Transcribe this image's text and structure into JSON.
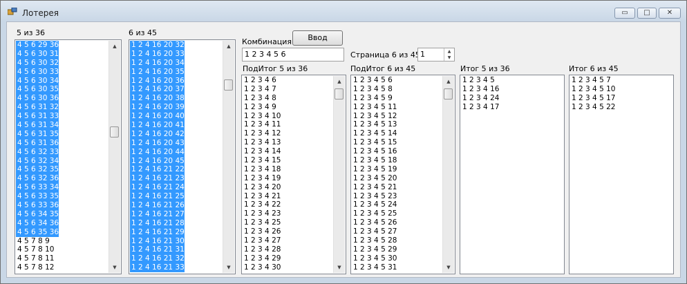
{
  "window": {
    "title": "Лотерея",
    "minimize": "▭",
    "maximize": "□",
    "close": "✕"
  },
  "labels": {
    "five_of_36": "5 из 36",
    "six_of_45": "6 из 45",
    "combination": "Комбинация",
    "page": "Страница 6 из 45",
    "subtotal_5_36": "ПодИтог 5 из 36",
    "subtotal_6_45": "ПодИтог 6 из 45",
    "total_5_36": "Итог 5 из 36",
    "total_6_45": "Итог 6 из 45"
  },
  "enter_button": "Ввод",
  "combination_value": "1 2 3 4 5 6",
  "page_spinner_value": "1",
  "list_5_36": [
    {
      "text": "4 5 6 29 36",
      "selected": true
    },
    {
      "text": "4 5 6 30 31",
      "selected": true
    },
    {
      "text": "4 5 6 30 32",
      "selected": true
    },
    {
      "text": "4 5 6 30 33",
      "selected": true
    },
    {
      "text": "4 5 6 30 34",
      "selected": true
    },
    {
      "text": "4 5 6 30 35",
      "selected": true
    },
    {
      "text": "4 5 6 30 36",
      "selected": true
    },
    {
      "text": "4 5 6 31 32",
      "selected": true
    },
    {
      "text": "4 5 6 31 33",
      "selected": true
    },
    {
      "text": "4 5 6 31 34",
      "selected": true
    },
    {
      "text": "4 5 6 31 35",
      "selected": true
    },
    {
      "text": "4 5 6 31 36",
      "selected": true
    },
    {
      "text": "4 5 6 32 33",
      "selected": true
    },
    {
      "text": "4 5 6 32 34",
      "selected": true
    },
    {
      "text": "4 5 6 32 35",
      "selected": true
    },
    {
      "text": "4 5 6 32 36",
      "selected": true
    },
    {
      "text": "4 5 6 33 34",
      "selected": true
    },
    {
      "text": "4 5 6 33 35",
      "selected": true
    },
    {
      "text": "4 5 6 33 36",
      "selected": true
    },
    {
      "text": "4 5 6 34 35",
      "selected": true
    },
    {
      "text": "4 5 6 34 36",
      "selected": true
    },
    {
      "text": "4 5 6 35 36",
      "selected": true
    },
    {
      "text": "4 5 7 8 9",
      "selected": false
    },
    {
      "text": "4 5 7 8 10",
      "selected": false
    },
    {
      "text": "4 5 7 8 11",
      "selected": false
    },
    {
      "text": "4 5 7 8 12",
      "selected": false
    }
  ],
  "list_6_45": [
    {
      "text": "1 2 4 16 20 32",
      "selected": true
    },
    {
      "text": "1 2 4 16 20 33",
      "selected": true
    },
    {
      "text": "1 2 4 16 20 34",
      "selected": true
    },
    {
      "text": "1 2 4 16 20 35",
      "selected": true
    },
    {
      "text": "1 2 4 16 20 36",
      "selected": true
    },
    {
      "text": "1 2 4 16 20 37",
      "selected": true
    },
    {
      "text": "1 2 4 16 20 38",
      "selected": true
    },
    {
      "text": "1 2 4 16 20 39",
      "selected": true
    },
    {
      "text": "1 2 4 16 20 40",
      "selected": true
    },
    {
      "text": "1 2 4 16 20 41",
      "selected": true
    },
    {
      "text": "1 2 4 16 20 42",
      "selected": true
    },
    {
      "text": "1 2 4 16 20 43",
      "selected": true
    },
    {
      "text": "1 2 4 16 20 44",
      "selected": true
    },
    {
      "text": "1 2 4 16 20 45",
      "selected": true
    },
    {
      "text": "1 2 4 16 21 22",
      "selected": true
    },
    {
      "text": "1 2 4 16 21 23",
      "selected": true
    },
    {
      "text": "1 2 4 16 21 24",
      "selected": true
    },
    {
      "text": "1 2 4 16 21 25",
      "selected": true
    },
    {
      "text": "1 2 4 16 21 26",
      "selected": true
    },
    {
      "text": "1 2 4 16 21 27",
      "selected": true
    },
    {
      "text": "1 2 4 16 21 28",
      "selected": true
    },
    {
      "text": "1 2 4 16 21 29",
      "selected": true
    },
    {
      "text": "1 2 4 16 21 30",
      "selected": true
    },
    {
      "text": "1 2 4 16 21 31",
      "selected": true
    },
    {
      "text": "1 2 4 16 21 32",
      "selected": true
    },
    {
      "text": "1 2 4 16 21 33",
      "selected": true
    }
  ],
  "subtotal_5_36_items": [
    "1 2 3 4 6",
    "1 2 3 4 7",
    "1 2 3 4 8",
    "1 2 3 4 9",
    "1 2 3 4 10",
    "1 2 3 4 11",
    "1 2 3 4 12",
    "1 2 3 4 13",
    "1 2 3 4 14",
    "1 2 3 4 15",
    "1 2 3 4 18",
    "1 2 3 4 19",
    "1 2 3 4 20",
    "1 2 3 4 21",
    "1 2 3 4 22",
    "1 2 3 4 23",
    "1 2 3 4 25",
    "1 2 3 4 26",
    "1 2 3 4 27",
    "1 2 3 4 28",
    "1 2 3 4 29",
    "1 2 3 4 30"
  ],
  "subtotal_6_45_items": [
    "1 2 3 4 5 6",
    "1 2 3 4 5 8",
    "1 2 3 4 5 9",
    "1 2 3 4 5 11",
    "1 2 3 4 5 12",
    "1 2 3 4 5 13",
    "1 2 3 4 5 14",
    "1 2 3 4 5 15",
    "1 2 3 4 5 16",
    "1 2 3 4 5 18",
    "1 2 3 4 5 19",
    "1 2 3 4 5 20",
    "1 2 3 4 5 21",
    "1 2 3 4 5 23",
    "1 2 3 4 5 24",
    "1 2 3 4 5 25",
    "1 2 3 4 5 26",
    "1 2 3 4 5 27",
    "1 2 3 4 5 28",
    "1 2 3 4 5 29",
    "1 2 3 4 5 30",
    "1 2 3 4 5 31"
  ],
  "total_5_36_items": [
    "1 2 3 4 5",
    "1 2 3 4 16",
    "1 2 3 4 24",
    "1 2 3 4 17"
  ],
  "total_6_45_items": [
    "1 2 3 4 5 7",
    "1 2 3 4 5 10",
    "1 2 3 4 5 17",
    "1 2 3 4 5 22"
  ],
  "colors": {
    "selection": "#3399ff",
    "selection_text": "#ffffff"
  },
  "icons": {
    "scroll_up": "▲",
    "scroll_down": "▼",
    "spin_up": "▲",
    "spin_down": "▼"
  }
}
